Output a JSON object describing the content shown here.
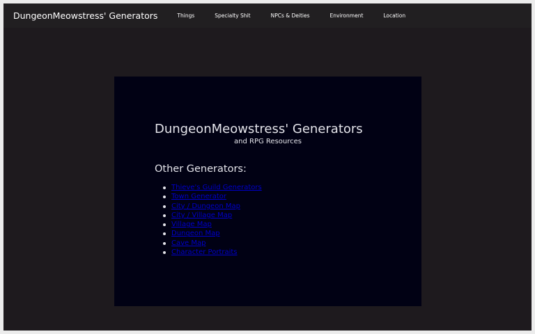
{
  "navbar": {
    "brand": "DungeonMeowstress' Generators",
    "items": [
      {
        "label": "Things"
      },
      {
        "label": "Specialty Shit"
      },
      {
        "label": "NPCs & Deities"
      },
      {
        "label": "Environment"
      },
      {
        "label": "Location"
      }
    ]
  },
  "main": {
    "title": "DungeonMeowstress' Generators",
    "subtitle": "and RPG Resources",
    "section_heading": "Other Generators:",
    "links": [
      {
        "label": "Thieve's Guild Generators"
      },
      {
        "label": "Town Generator"
      },
      {
        "label": "City / Dungeon Map"
      },
      {
        "label": "City / Village Map"
      },
      {
        "label": "Village Map"
      },
      {
        "label": "Dungeon Map"
      },
      {
        "label": "Cave Map"
      },
      {
        "label": "Character Portraits"
      }
    ]
  },
  "colors": {
    "page_background": "#1e1a1e",
    "navbar_background": "#211f21",
    "panel_background": "#010114",
    "text": "#e4e4ea",
    "link": "#0000cc"
  }
}
